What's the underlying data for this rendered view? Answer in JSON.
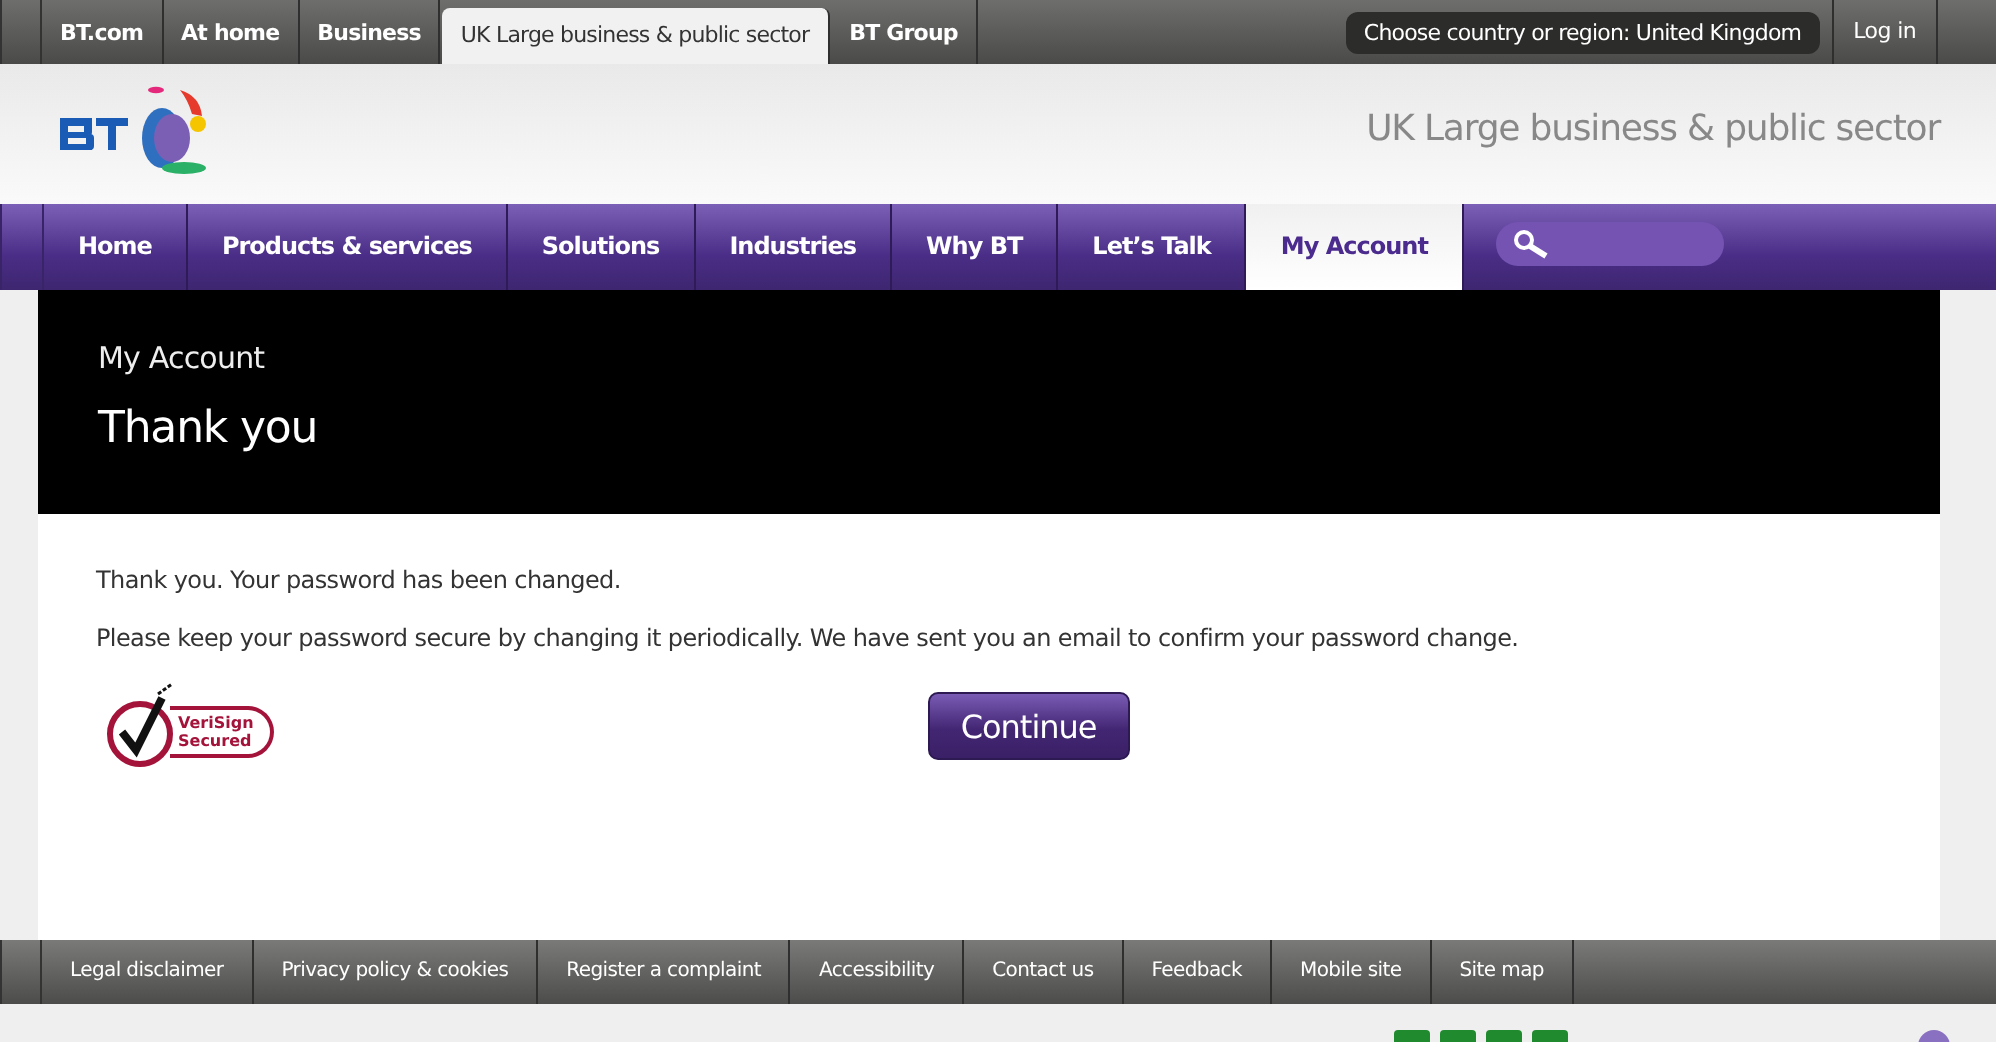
{
  "top_tabs": [
    {
      "label": "BT.com",
      "selected": false
    },
    {
      "label": "At home",
      "selected": false
    },
    {
      "label": "Business",
      "selected": false
    },
    {
      "label": "UK Large business & public sector",
      "selected": true
    },
    {
      "label": "BT Group",
      "selected": false
    }
  ],
  "region_selector": "Choose country or region: United Kingdom",
  "login": "Log in",
  "header": {
    "site_title": "UK Large business & public sector"
  },
  "nav": [
    {
      "label": "Home",
      "selected": false
    },
    {
      "label": "Products & services",
      "selected": false
    },
    {
      "label": "Solutions",
      "selected": false
    },
    {
      "label": "Industries",
      "selected": false
    },
    {
      "label": "Why BT",
      "selected": false
    },
    {
      "label": "Let’s Talk",
      "selected": false
    },
    {
      "label": "My Account",
      "selected": true
    }
  ],
  "page": {
    "section": "My Account",
    "title": "Thank you",
    "messages": [
      "Thank you. Your password has been changed.",
      "Please keep your password secure by changing it periodically. We have sent you an email to confirm your password change."
    ],
    "seal_text": [
      "VeriSign",
      "Secured"
    ],
    "button": "Continue"
  },
  "footer_links": [
    "Legal disclaimer",
    "Privacy policy & cookies",
    "Register a complaint",
    "Accessibility",
    "Contact us",
    "Feedback",
    "Mobile site",
    "Site map"
  ]
}
